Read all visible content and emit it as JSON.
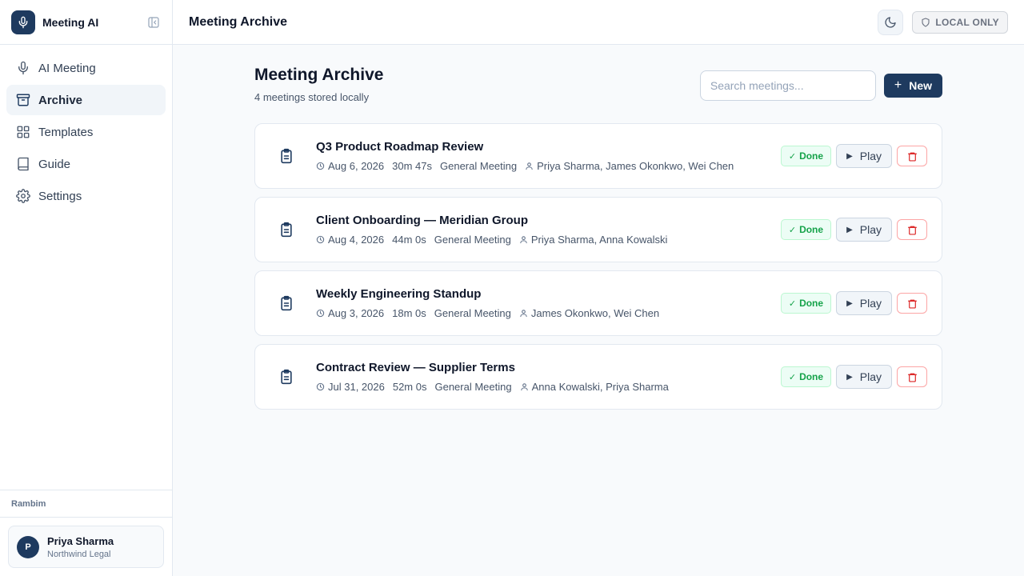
{
  "app": {
    "name": "Meeting AI",
    "icons": {
      "logo": "microphone-icon",
      "collapse": "sidebar-collapse-icon"
    }
  },
  "sidebar": {
    "items": [
      {
        "label": "AI Meeting",
        "icon": "microphone-icon",
        "active": false
      },
      {
        "label": "Archive",
        "icon": "archive-box-icon",
        "active": true
      },
      {
        "label": "Templates",
        "icon": "grid-icon",
        "active": false
      },
      {
        "label": "Guide",
        "icon": "book-icon",
        "active": false
      },
      {
        "label": "Settings",
        "icon": "gear-icon",
        "active": false
      }
    ],
    "workspace_label": "Rambim",
    "user": {
      "initial": "P",
      "name": "Priya Sharma",
      "org": "Northwind Legal"
    }
  },
  "topbar": {
    "title": "Meeting Archive",
    "theme_icon": "moon-icon",
    "badge": {
      "label": "LOCAL ONLY",
      "icon": "shield-icon"
    }
  },
  "main": {
    "title": "Meeting Archive",
    "subtitle": "4 meetings stored locally",
    "search": {
      "placeholder": "Search meetings...",
      "value": ""
    },
    "new_button": {
      "plus": "+",
      "label": "New"
    },
    "meetings": [
      {
        "title": "Q3 Product Roadmap Review",
        "date": "Aug 6, 2026",
        "duration": "30m 47s",
        "type": "General Meeting",
        "participants": "Priya Sharma, James Okonkwo, Wei Chen",
        "status": "Done",
        "play_label": "Play"
      },
      {
        "title": "Client Onboarding — Meridian Group",
        "date": "Aug 4, 2026",
        "duration": "44m 0s",
        "type": "General Meeting",
        "participants": "Priya Sharma, Anna Kowalski",
        "status": "Done",
        "play_label": "Play"
      },
      {
        "title": "Weekly Engineering Standup",
        "date": "Aug 3, 2026",
        "duration": "18m 0s",
        "type": "General Meeting",
        "participants": "James Okonkwo, Wei Chen",
        "status": "Done",
        "play_label": "Play"
      },
      {
        "title": "Contract Review — Supplier Terms",
        "date": "Jul 31, 2026",
        "duration": "52m 0s",
        "type": "General Meeting",
        "participants": "Anna Kowalski, Priya Sharma",
        "status": "Done",
        "play_label": "Play"
      }
    ]
  },
  "colors": {
    "brand": "#1e3a5f",
    "done": "#16a34a",
    "danger": "#dc2626",
    "muted": "#64748b"
  }
}
